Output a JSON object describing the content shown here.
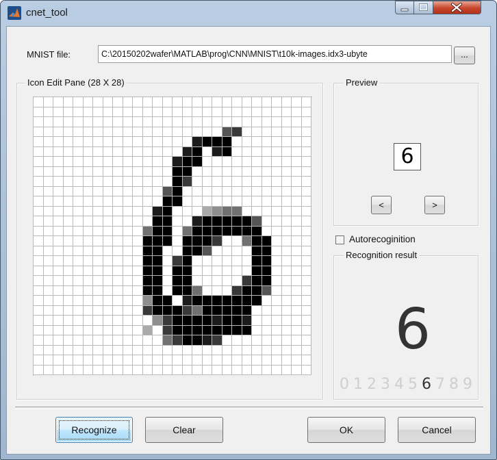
{
  "window": {
    "title": "cnet_tool",
    "colors": {
      "titlebar": "#b9cde3",
      "close": "#c7452a",
      "client": "#f0f0f0"
    }
  },
  "file": {
    "label": "MNIST file:",
    "path": "C:\\20150202wafer\\MATLAB\\prog\\CNN\\MNIST\\t10k-images.idx3-ubyte",
    "browse_label": "..."
  },
  "edit_pane": {
    "title": "Icon Edit Pane (28 X 28)",
    "grid_rows": [
      "............................",
      "............................",
      "............................",
      "...................67.......",
      "................8999........",
      "...............89.89........",
      "..............899...........",
      "..............99............",
      "..............97............",
      ".............69.............",
      ".............99.............",
      "............89...3455.......",
      "............99..8999996.....",
      "...........599.59999999.....",
      "...........999.9997..599....",
      "...........99..996....99....",
      "...........99.79......99....",
      "...........99.99......99....",
      "...........99.99.....799....",
      "...........99.995...7996....",
      "...........499.89999999.....",
      "...........79997599999......",
      "............4799998998......",
      "...........3.799999999......",
      ".............579987.........",
      "............................",
      "............................",
      "............................"
    ]
  },
  "preview": {
    "title": "Preview",
    "digit": "6",
    "prev_label": "<",
    "next_label": ">"
  },
  "autorecognition": {
    "label": "Autorecoginition",
    "checked": false
  },
  "result": {
    "title": "Recognition result",
    "predicted": "6",
    "digits": [
      "0",
      "1",
      "2",
      "3",
      "4",
      "5",
      "6",
      "7",
      "8",
      "9"
    ],
    "active_index": 6
  },
  "buttons": {
    "recognize": "Recognize",
    "clear": "Clear",
    "ok": "OK",
    "cancel": "Cancel"
  }
}
